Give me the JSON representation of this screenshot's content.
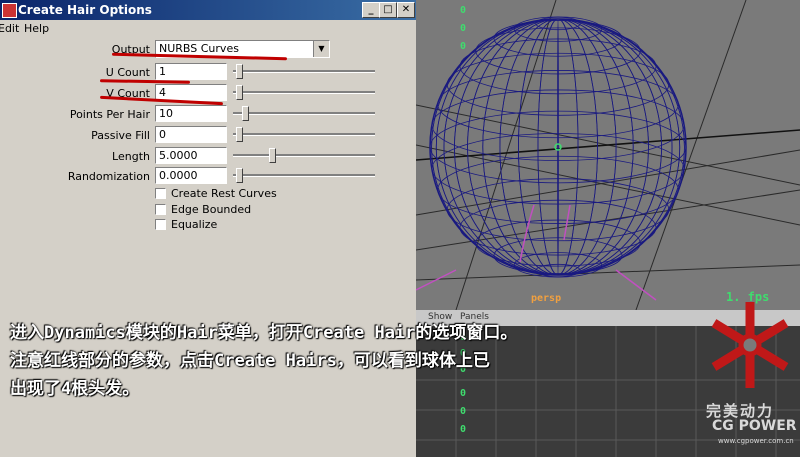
{
  "window": {
    "title": "Create Hair Options",
    "controls": {
      "minimize": "_",
      "maximize": "□",
      "close": "✕"
    }
  },
  "menu": {
    "items": [
      "Edit",
      "Help"
    ]
  },
  "form": {
    "output": {
      "label": "Output",
      "value": "NURBS Curves"
    },
    "u_count": {
      "label": "U Count",
      "value": "1",
      "slider": 0.02
    },
    "v_count": {
      "label": "V Count",
      "value": "4",
      "slider": 0.02
    },
    "points_per_hair": {
      "label": "Points Per Hair",
      "value": "10",
      "slider": 0.07
    },
    "passive_fill": {
      "label": "Passive Fill",
      "value": "0",
      "slider": 0.02
    },
    "length": {
      "label": "Length",
      "value": "5.0000",
      "slider": 0.27
    },
    "randomization": {
      "label": "Randomization",
      "value": "0.0000",
      "slider": 0.02
    },
    "checkboxes": [
      "Create Rest Curves",
      "Edge Bounded",
      "Equalize"
    ]
  },
  "viewport": {
    "numbers": [
      "0",
      "0",
      "0"
    ],
    "camera": "persp",
    "fps": "1.  fps",
    "panel_menu": [
      "Show",
      "Panels"
    ],
    "numbers_bottom": [
      "0",
      "0",
      "0",
      "0",
      "0",
      "0"
    ],
    "colors": {
      "wire": "#1a1a80",
      "grid": "#2a2a2a",
      "green": "#3fdc6e"
    }
  },
  "caption": {
    "line1": "进入Dynamics模块的Hair菜单，打开Create Hair的选项窗口。",
    "line2": "注意红线部分的参数，点击Create Hairs，可以看到球体上已",
    "line3": "出现了4根头发。"
  },
  "logo": {
    "name_cn": "完美动力",
    "name_en": "CG POWER",
    "url": "www.cgpower.com.cn",
    "color": "#c01818"
  }
}
